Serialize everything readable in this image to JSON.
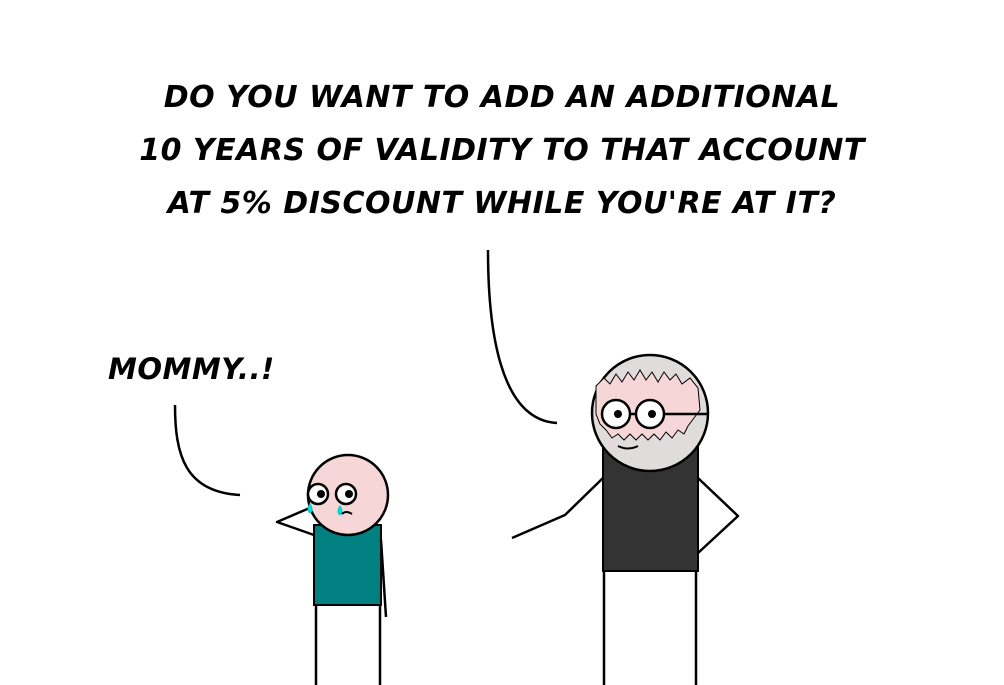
{
  "dialogue": {
    "adult_lines": [
      "DO YOU WANT TO ADD AN ADDITIONAL",
      "10 YEARS OF VALIDITY TO THAT ACCOUNT",
      "AT 5% DISCOUNT WHILE YOU'RE AT IT?"
    ],
    "kid_line": "MOMMY..!"
  },
  "colors": {
    "background": "#ffffff",
    "ink": "#000000",
    "skin": "#f6d6d6",
    "kid_shirt": "#008080",
    "adult_shirt": "#333333",
    "adult_hair": "#e0dcdc",
    "tears": "#00e0e0"
  }
}
